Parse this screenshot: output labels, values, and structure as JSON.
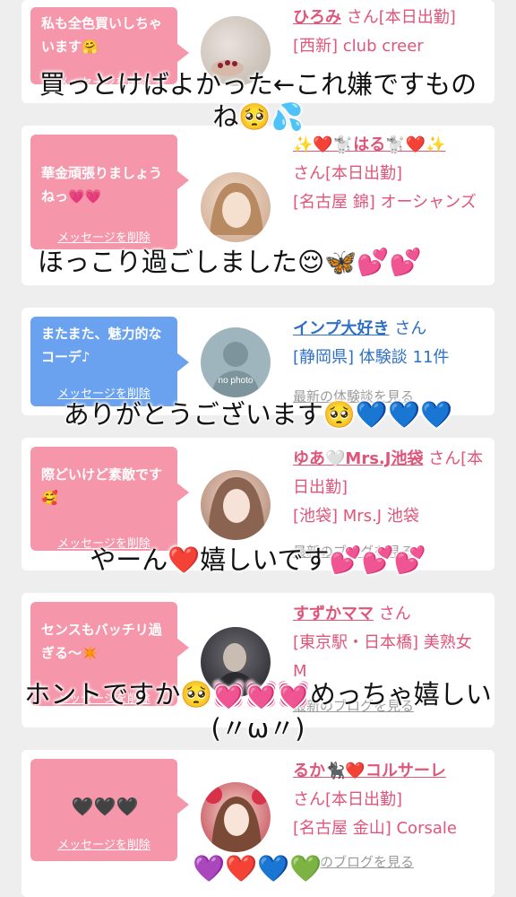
{
  "delete_label": "メッセージを削除",
  "cards": [
    {
      "message": "私も全色買いしちゃいます🤗",
      "name": "ひろみ",
      "honorific": "さん[本日出勤]",
      "details": "[西新] club creer",
      "link": ""
    },
    {
      "message": "華金頑張りましょうねっ💗💗",
      "name": "✨❤️🐩はる🐩❤️✨",
      "honorific": "さん[本日出勤]",
      "details": "[名古屋 錦] オーシャンズ",
      "link": ""
    },
    {
      "message": "またまた、魅力的なコーデ♪",
      "name": "インプ大好き",
      "honorific": "さん",
      "details": "[静岡県] 体験談 11件",
      "link": "最新の体験談を見る",
      "avatar_text": "no photo"
    },
    {
      "message": "際どいけど素敵です🥰",
      "name": "ゆあ🤍Mrs.J池袋",
      "honorific": "さん[本日出勤]",
      "details": "[池袋] Mrs.J 池袋",
      "link": "最新のブログを見る"
    },
    {
      "message": "センスもバッチリ過ぎる〜✴️",
      "name": "すずかママ",
      "honorific": "さん",
      "details": "[東京駅・日本橋] 美熟女 M",
      "link": "最新のブログを見る"
    },
    {
      "message": "🖤🖤🖤",
      "name": "るか🐈‍⬛❤️コルサーレ",
      "honorific": "さん[本日出勤]",
      "details": "[名古屋 金山] Corsale",
      "link": "最新のブログを見る"
    }
  ],
  "captions": [
    "買っとけばよかった←これ嫌ですもの",
    "ね🥺💦",
    "ほっこり過ごしました😌🦋💕💕",
    "ありがとうございます🥺💙💙💙",
    "やーん❤️嬉しいです💕💕💕",
    "ホントですか🥺💓💓💓めっちゃ嬉しい",
    "(〃ω〃)",
    "💜❤️💙💚"
  ],
  "colors": {
    "pink_bubble": "#f696aa",
    "blue_bubble": "#6aa2ef",
    "pink_text": "#e0557a",
    "blue_text": "#2f70c4"
  }
}
